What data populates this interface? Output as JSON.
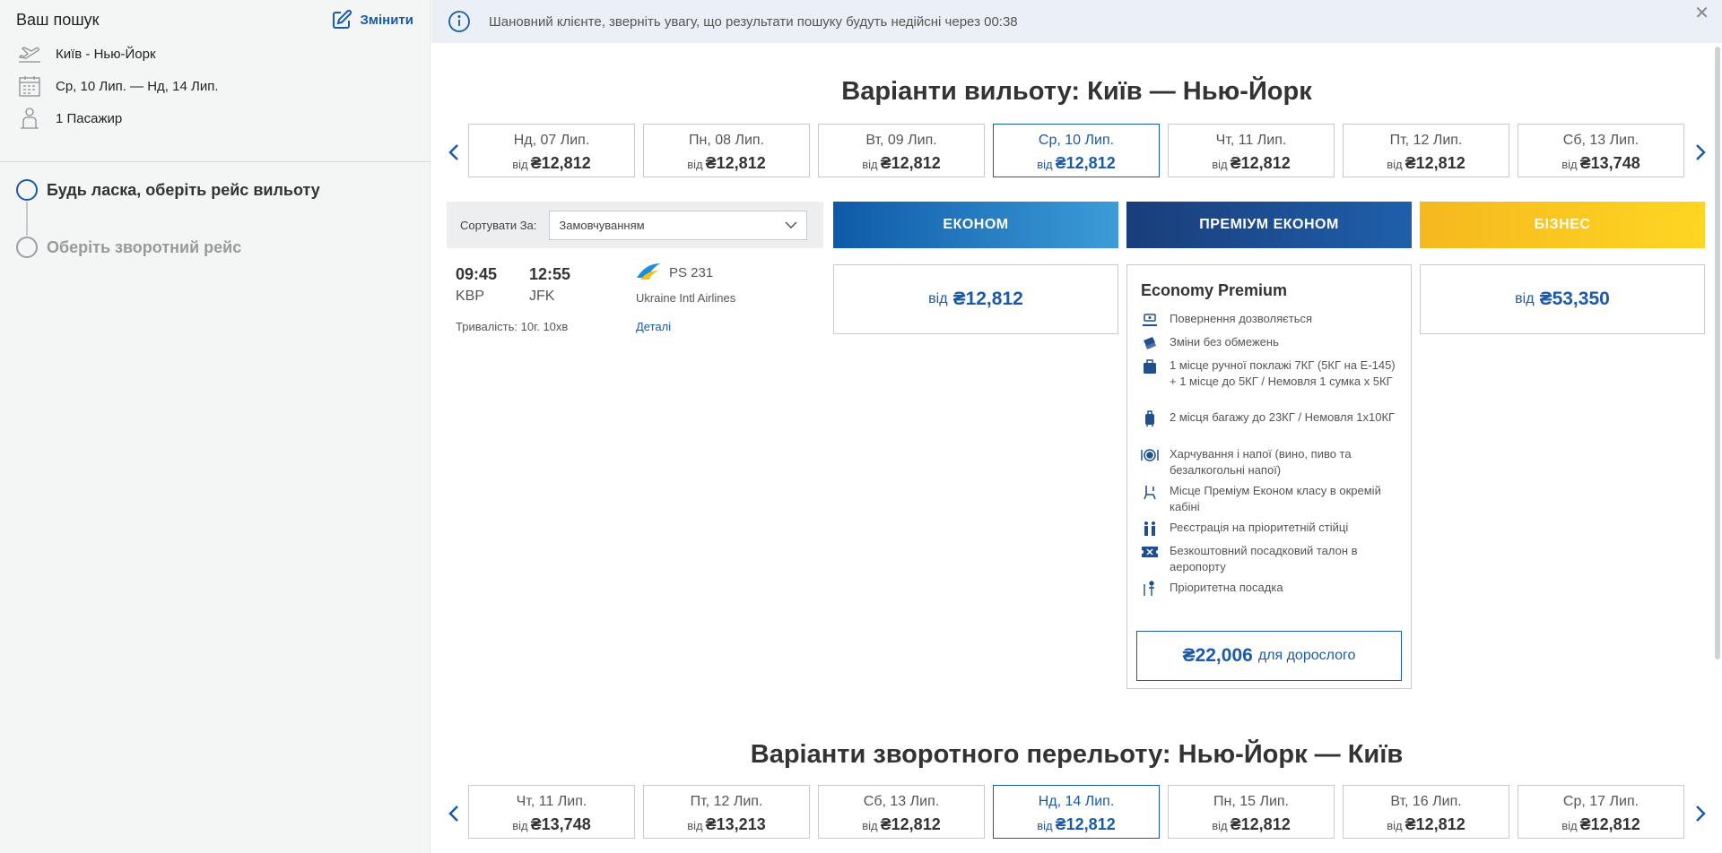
{
  "sidebar": {
    "title": "Ваш пошук",
    "edit_label": "Змінити",
    "route": "Київ - Нью-Йорк",
    "dates": "Ср, 10 Лип. — Нд, 14 Лип.",
    "passengers": "1 Пасажир",
    "steps": [
      {
        "label": "Будь ласка, оберіть рейс вильоту",
        "active": true
      },
      {
        "label": "Оберіть зворотний рейс",
        "active": false
      }
    ]
  },
  "notice": {
    "text": "Шановний клієнте, зверніть увагу, що результати пошуку будуть недійсні через 00:38",
    "close": "✕"
  },
  "outbound": {
    "title": "Варіанти вильоту: Київ — Нью-Йорк",
    "from_label": "від",
    "dates": [
      {
        "label": "Нд, 07 Лип.",
        "price": "₴12,812"
      },
      {
        "label": "Пн, 08 Лип.",
        "price": "₴12,812"
      },
      {
        "label": "Вт, 09 Лип.",
        "price": "₴12,812"
      },
      {
        "label": "Ср, 10 Лип.",
        "price": "₴12,812"
      },
      {
        "label": "Чт, 11 Лип.",
        "price": "₴12,812"
      },
      {
        "label": "Пт, 12 Лип.",
        "price": "₴12,812"
      },
      {
        "label": "Сб, 13 Лип.",
        "price": "₴13,748"
      }
    ],
    "selected_index": 3
  },
  "sort": {
    "label": "Сортувати За:",
    "value": "Замовчуванням"
  },
  "cabins": {
    "economy": "ЕКОНОМ",
    "premium": "ПРЕМІУМ ЕКОНОМ",
    "business": "БІЗНЕС"
  },
  "flight": {
    "dep_time": "09:45",
    "arr_time": "12:55",
    "dep_airport": "KBP",
    "arr_airport": "JFK",
    "number": "PS 231",
    "airline": "Ukraine Intl Airlines",
    "duration": "Тривалість: 10г. 10хв",
    "details": "Деталі"
  },
  "fares": {
    "from_label": "від",
    "economy": "₴12,812",
    "business": "₴53,350"
  },
  "premium": {
    "title": "Economy Premium",
    "features": [
      {
        "icon": "refund-icon",
        "text": "Повернення дозволяється"
      },
      {
        "icon": "ticket-change-icon",
        "text": "Зміни без обмежень"
      },
      {
        "icon": "hand-luggage-icon",
        "text": "1 місце ручної поклажі 7КГ (5КГ на E-145) + 1 місце до 5КГ / Немовля 1 сумка х 5КГ"
      },
      {
        "icon": "checked-baggage-icon",
        "text": "2 місця багажу до 23КГ / Немовля 1х10КГ"
      },
      {
        "icon": "meal-icon",
        "text": "Харчування і напої (вино, пиво та безалкогольні напої)"
      },
      {
        "icon": "seat-icon",
        "text": "Місце Преміум Економ класу в окремій кабіні"
      },
      {
        "icon": "priority-checkin-icon",
        "text": "Реєстрація на пріоритетній стійці"
      },
      {
        "icon": "boarding-pass-icon",
        "text": "Безкоштовний посадковий талон в аеропорту"
      },
      {
        "icon": "priority-boarding-icon",
        "text": "Пріоритетна посадка"
      }
    ],
    "price": "₴22,006",
    "price_label": "для дорослого"
  },
  "return": {
    "title": "Варіанти зворотного перельоту: Нью-Йорк — Київ",
    "dates": [
      {
        "label": "Чт, 11 Лип.",
        "price": "₴13,748"
      },
      {
        "label": "Пт, 12 Лип.",
        "price": "₴13,213"
      },
      {
        "label": "Сб, 13 Лип.",
        "price": "₴12,812"
      },
      {
        "label": "Нд, 14 Лип.",
        "price": "₴12,812"
      },
      {
        "label": "Пн, 15 Лип.",
        "price": "₴12,812"
      },
      {
        "label": "Вт, 16 Лип.",
        "price": "₴12,812"
      },
      {
        "label": "Ср, 17 Лип.",
        "price": "₴12,812"
      }
    ],
    "selected_index": 3
  },
  "colors": {
    "accent": "#1a5aa8",
    "economy_start": "#0d5aa7",
    "premium_start": "#1a3d7a",
    "business_start": "#f5b81f"
  }
}
